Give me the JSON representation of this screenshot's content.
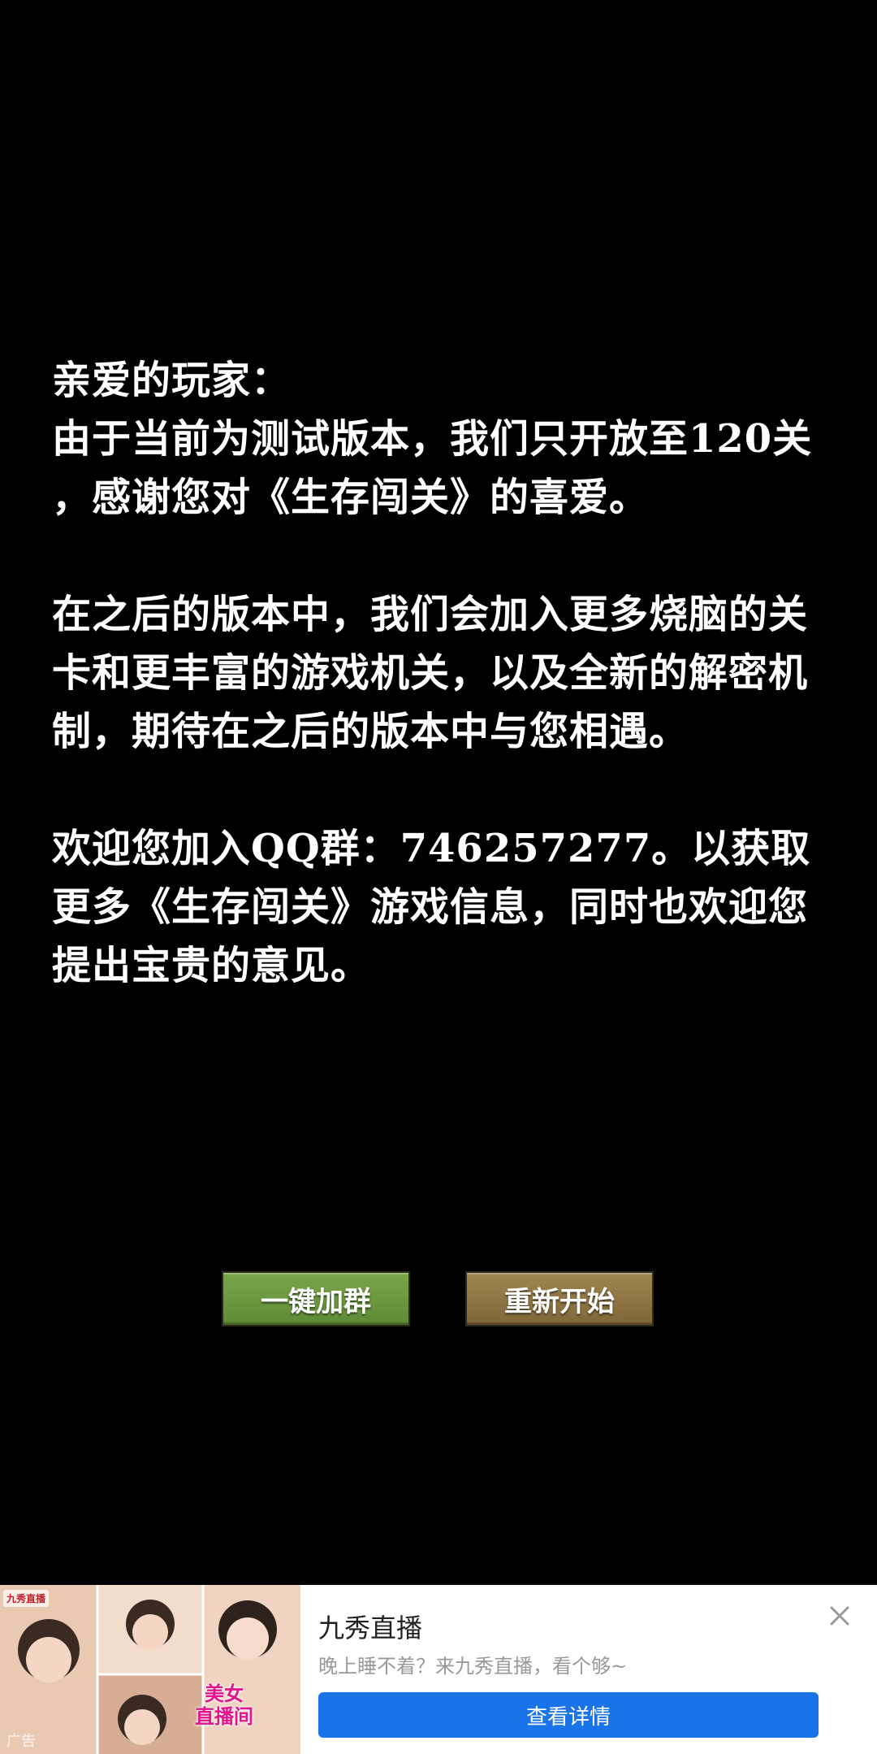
{
  "message": {
    "greeting": "亲爱的玩家：",
    "para1_line1": "由于当前为测试版本，我们只开放至120关",
    "para1_line2": "，感谢您对《生存闯关》的喜爱。",
    "para2": "在之后的版本中，我们会加入更多烧脑的关卡和更丰富的游戏机关，以及全新的解密机制，期待在之后的版本中与您相遇。",
    "para3": "欢迎您加入QQ群：746257277。以获取更多《生存闯关》游戏信息，同时也欢迎您提出宝贵的意见。"
  },
  "buttons": {
    "join_group": "一键加群",
    "restart": "重新开始"
  },
  "ad": {
    "title": "九秀直播",
    "subtitle": "晚上睡不着？来九秀直播，看个够~",
    "cta": "查看详情",
    "badge": "广告",
    "image_caption_line1": "美女",
    "image_caption_line2": "直播间",
    "logo_text": "九秀直播",
    "close_icon": "close-icon"
  }
}
